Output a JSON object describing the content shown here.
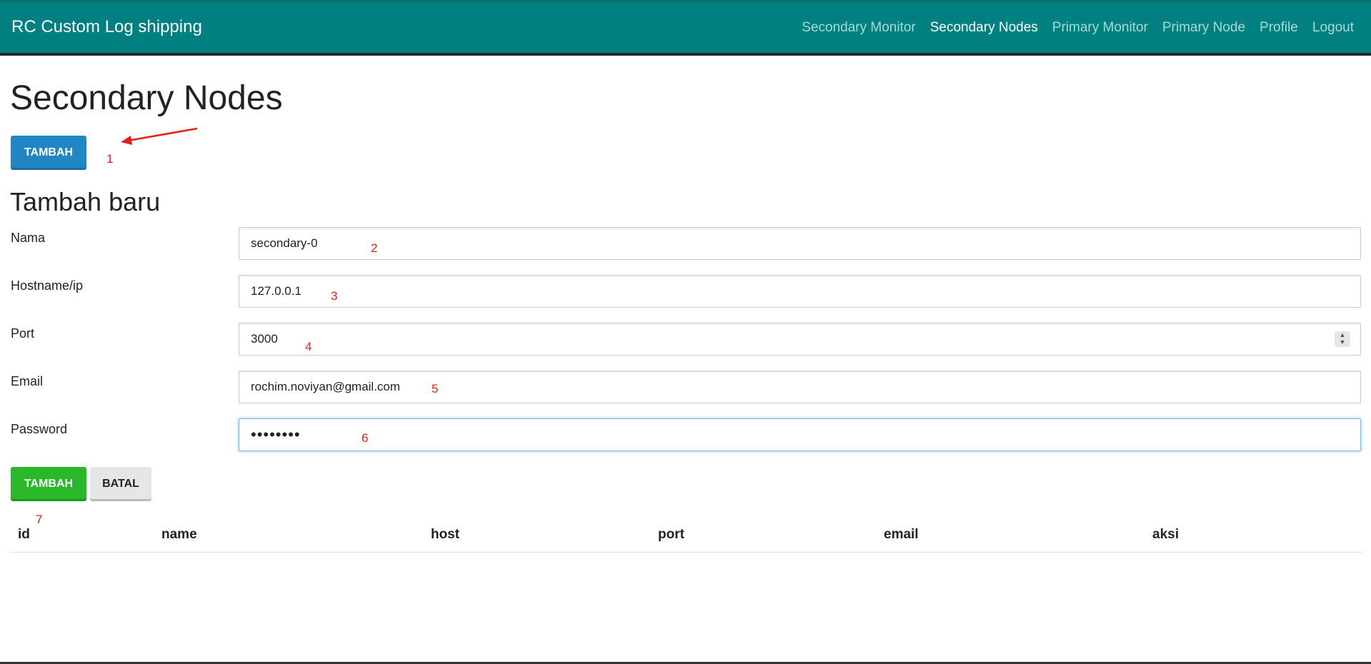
{
  "header": {
    "brand": "RC Custom Log shipping",
    "nav": [
      {
        "label": "Secondary Monitor",
        "active": false
      },
      {
        "label": "Secondary Nodes",
        "active": true
      },
      {
        "label": "Primary Monitor",
        "active": false
      },
      {
        "label": "Primary Node",
        "active": false
      },
      {
        "label": "Profile",
        "active": false
      },
      {
        "label": "Logout",
        "active": false
      }
    ]
  },
  "page": {
    "title": "Secondary Nodes",
    "add_button": "TAMBAH"
  },
  "form": {
    "title": "Tambah baru",
    "fields": {
      "nama": {
        "label": "Nama",
        "value": "secondary-0"
      },
      "hostname": {
        "label": "Hostname/ip",
        "value": "127.0.0.1"
      },
      "port": {
        "label": "Port",
        "value": "3000"
      },
      "email": {
        "label": "Email",
        "value": "rochim.noviyan@gmail.com"
      },
      "password": {
        "label": "Password",
        "value": "••••••••"
      }
    },
    "submit_button": "TAMBAH",
    "cancel_button": "BATAL"
  },
  "table": {
    "columns": [
      "id",
      "name",
      "host",
      "port",
      "email",
      "aksi"
    ],
    "rows": []
  },
  "annotations": [
    "1",
    "2",
    "3",
    "4",
    "5",
    "6",
    "7"
  ],
  "colors": {
    "topbar": "#008080",
    "add_button": "#2186c4",
    "submit_button": "#2ab82a",
    "annotation": "#e0201a"
  },
  "icons": {
    "port_spinner": "spinner-icon",
    "arrow": "arrow-annotation-icon"
  }
}
